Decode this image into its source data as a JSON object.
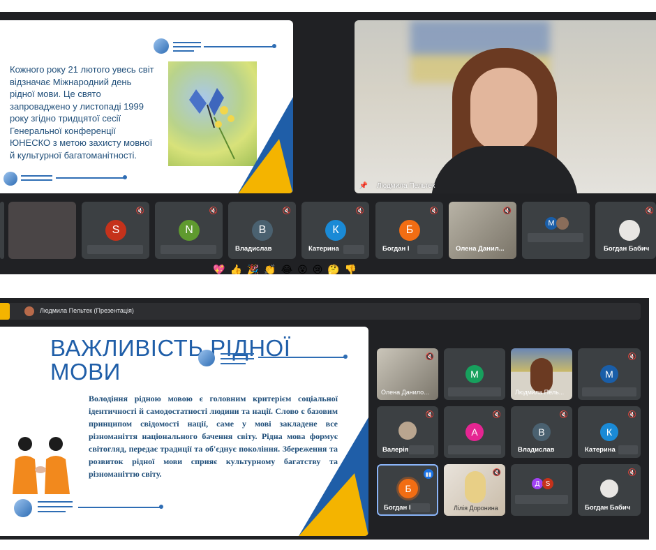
{
  "top": {
    "slide_text": "Кожного року 21 лютого увесь світ відзначає Міжнародний день рідної мови. Це свято запроваджено у листопаді 1999 року згідно тридцятої сесії Генеральної конференції ЮНЕСКО з метою захисту мовної й культурної багатоманітності.",
    "presenter_name": "Людмила Пельтек",
    "participants": [
      {
        "initial": "S",
        "color": "#c5321b",
        "name": ""
      },
      {
        "initial": "N",
        "color": "#5f9a2f",
        "name": ""
      },
      {
        "initial": "В",
        "color": "#4a6170",
        "name": "Владислав"
      },
      {
        "initial": "К",
        "color": "#1a8ad6",
        "name": "Катерина"
      },
      {
        "initial": "Б",
        "color": "#f26d13",
        "name": "Богдан І"
      },
      {
        "initial": "",
        "color": "",
        "name": "Олена Данил..."
      },
      {
        "initial": "M",
        "color": "#1a5ea8",
        "name": ""
      },
      {
        "initial": "",
        "color": "",
        "name": "Богдан Бабич"
      }
    ],
    "reactions": [
      "💖",
      "👍",
      "🎉",
      "👏",
      "😂",
      "😮",
      "😢",
      "🤔",
      "👎"
    ]
  },
  "bottom": {
    "bar_title": "Людмила Пельтек (Презентація)",
    "slide_heading": "ВАЖЛИВІСТЬ РІДНОЇ МОВИ",
    "slide_body": "Володіння рідною мовою є головним критерієм соціальної ідентичності й самодостатності людини та нації. Слово є базовим принципом свідомості нації, саме у мові закладене все різноманіття національного бачення світу. Рідна мова формує світогляд, передає традиції та об'єднує покоління. Збереження та розвиток рідної мови сприяє культурному багатству та різноманіттю світу.",
    "grid": [
      {
        "initial": "",
        "color": "",
        "name": "Олена Данило..."
      },
      {
        "initial": "M",
        "color": "#17a05d",
        "name": ""
      },
      {
        "initial": "",
        "color": "",
        "name": "Людмила Пель..."
      },
      {
        "initial": "M",
        "color": "#1a5ea8",
        "name": ""
      },
      {
        "initial": "",
        "color": "",
        "name": "Валерія"
      },
      {
        "initial": "A",
        "color": "#e52592",
        "name": ""
      },
      {
        "initial": "В",
        "color": "#4a6170",
        "name": "Владислав"
      },
      {
        "initial": "К",
        "color": "#1a8ad6",
        "name": "Катерина"
      },
      {
        "initial": "Б",
        "color": "#f26d13",
        "name": "Богдан І"
      },
      {
        "initial": "",
        "color": "",
        "name": "Лілія Доронина"
      },
      {
        "initial": "Д",
        "color": "#a142f4",
        "name": ""
      },
      {
        "initial": "",
        "color": "",
        "name": "Богдан Бабич"
      }
    ],
    "second_initial": "S"
  }
}
